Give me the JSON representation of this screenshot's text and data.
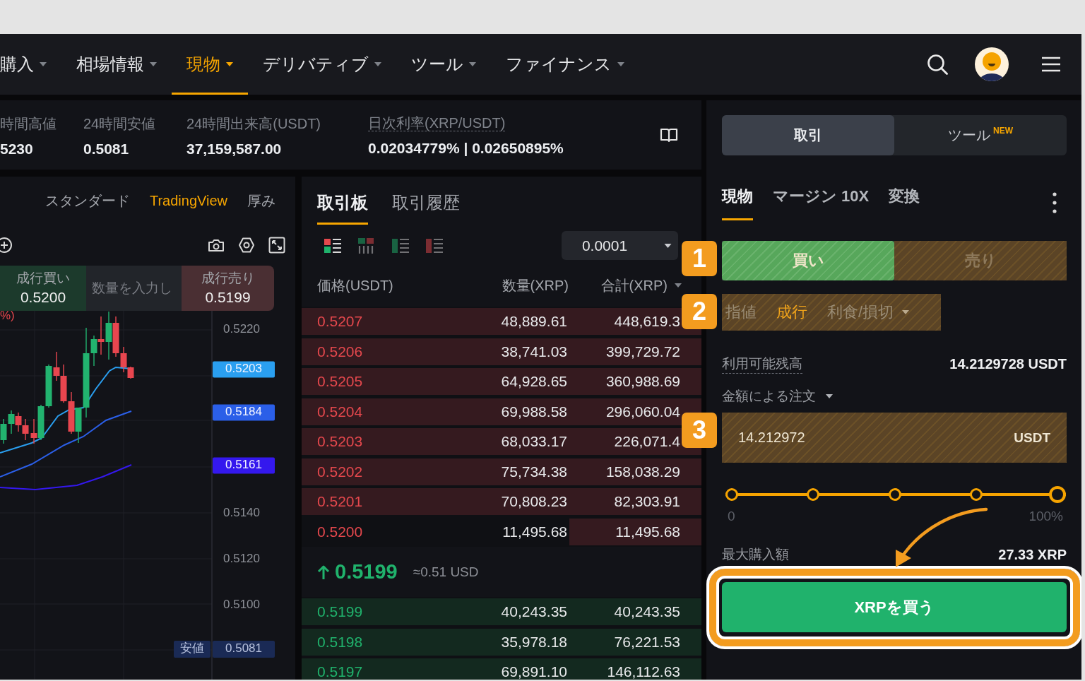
{
  "nav": {
    "items": [
      {
        "label": "購入",
        "selected": false
      },
      {
        "label": "相場情報",
        "selected": false
      },
      {
        "label": "現物",
        "selected": true
      },
      {
        "label": "デリバティブ",
        "selected": false
      },
      {
        "label": "ツール",
        "selected": false
      },
      {
        "label": "ファイナンス",
        "selected": false
      }
    ]
  },
  "ticker": {
    "stats": [
      {
        "label": "時間高値",
        "value": "5230",
        "underlined": false
      },
      {
        "label": "24時間安値",
        "value": "0.5081",
        "underlined": false
      },
      {
        "label": "24時間出来高(USDT)",
        "value": "37,159,587.00",
        "underlined": false
      },
      {
        "label": "日次利率(XRP/USDT)",
        "value": "0.02034779% | 0.02650895%",
        "underlined": true
      }
    ]
  },
  "chart": {
    "views": [
      {
        "label": "スタンダード",
        "selected": false
      },
      {
        "label": "TradingView",
        "selected": true
      },
      {
        "label": "厚み",
        "selected": false
      }
    ],
    "quick_trade": {
      "buy_label": "成行買い",
      "buy_price": "0.5200",
      "placeholder": "数量を入力し",
      "sell_label": "成行売り",
      "sell_price": "0.5199"
    },
    "legend": "%)",
    "axis_labels": [
      "0.5220",
      "0.5140",
      "0.5120",
      "0.5100"
    ],
    "price_tags": [
      {
        "label": "0.5203",
        "color": "#2a9ff0"
      },
      {
        "label": "0.5184",
        "color": "#2b5fe8"
      },
      {
        "label": "0.5161",
        "color": "#3418ee"
      }
    ],
    "low_tag": {
      "caption": "安値",
      "value": "0.5081"
    }
  },
  "order_book": {
    "tabs": [
      {
        "label": "取引板",
        "selected": true
      },
      {
        "label": "取引履歴",
        "selected": false
      }
    ],
    "layouts": [
      {
        "kind": "both",
        "selected": true
      },
      {
        "kind": "grid",
        "selected": false
      },
      {
        "kind": "bids",
        "selected": false
      },
      {
        "kind": "asks",
        "selected": false
      }
    ],
    "precision": "0.0001",
    "columns": [
      "価格(USDT)",
      "数量(XRP)",
      "合計(XRP)"
    ],
    "asks": [
      {
        "price": "0.5207",
        "amount": "48,889.61",
        "total": "448,619.3",
        "level": 1
      },
      {
        "price": "0.5206",
        "amount": "38,741.03",
        "total": "399,729.72",
        "level": 1
      },
      {
        "price": "0.5205",
        "amount": "64,928.65",
        "total": "360,988.69",
        "level": 1
      },
      {
        "price": "0.5204",
        "amount": "69,988.58",
        "total": "296,060.04",
        "level": 1
      },
      {
        "price": "0.5203",
        "amount": "68,033.17",
        "total": "226,071.4",
        "level": 1
      },
      {
        "price": "0.5202",
        "amount": "75,734.38",
        "total": "158,038.29",
        "level": 1
      },
      {
        "price": "0.5201",
        "amount": "70,808.23",
        "total": "82,303.91",
        "level": 1
      },
      {
        "price": "0.5200",
        "amount": "11,495.68",
        "total": "11,495.68",
        "level": 0.33
      }
    ],
    "last_price": {
      "value": "0.5199",
      "rising": true,
      "usd": "≈0.51 USD"
    },
    "bids": [
      {
        "price": "0.5199",
        "amount": "40,243.35",
        "total": "40,243.35",
        "level": 1
      },
      {
        "price": "0.5198",
        "amount": "35,978.18",
        "total": "76,221.53",
        "level": 1
      },
      {
        "price": "0.5197",
        "amount": "69,891.10",
        "total": "146,112.63",
        "level": 1
      }
    ]
  },
  "trade_panel": {
    "modes": [
      {
        "label": "取引",
        "selected": true
      },
      {
        "label": "ツール",
        "selected": false,
        "badge": "NEW"
      }
    ],
    "tabs": [
      {
        "label": "現物",
        "selected": true
      },
      {
        "label": "マージン 10X",
        "selected": false
      },
      {
        "label": "変換",
        "selected": false
      }
    ],
    "side_toggle": {
      "highlighted": true,
      "badge": "1",
      "options": [
        {
          "label": "買い",
          "kind": "buy",
          "selected": true
        },
        {
          "label": "売り",
          "kind": "sell",
          "selected": false
        }
      ]
    },
    "order_types": {
      "highlighted": true,
      "badge": "2",
      "options": [
        {
          "label": "指値",
          "selected": false,
          "dropdown": false
        },
        {
          "label": "成行",
          "selected": true,
          "dropdown": false
        },
        {
          "label": "利食/損切",
          "selected": false,
          "dropdown": true
        }
      ]
    },
    "balance": {
      "label": "利用可能残高",
      "value": "14.2129728 USDT"
    },
    "order_mode": "金額による注文",
    "amount": {
      "value": "14.212972",
      "unit": "USDT",
      "highlighted": true,
      "badge": "3"
    },
    "slider": {
      "level": 1,
      "min_label": "0",
      "max_label": "100%"
    },
    "max_buy": {
      "label": "最大購入額",
      "value": "27.33 XRP"
    },
    "submit": {
      "label": "XRPを買う",
      "highlighted": true,
      "arrow": true
    }
  }
}
